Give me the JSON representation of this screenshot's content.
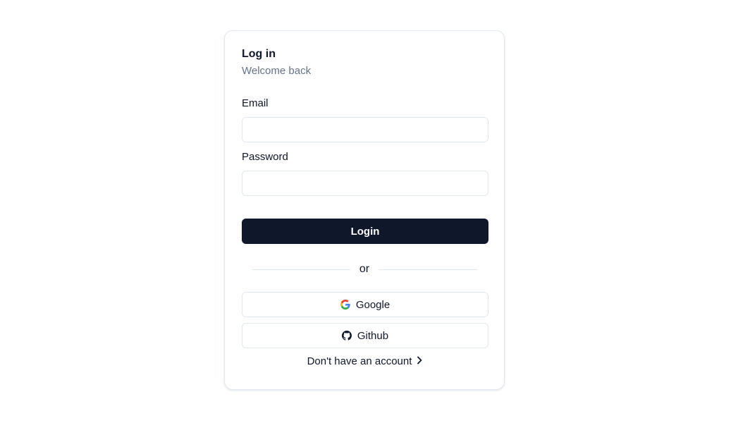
{
  "login_card": {
    "title": "Log in",
    "subtitle": "Welcome back",
    "email": {
      "label": "Email",
      "value": "",
      "placeholder": ""
    },
    "password": {
      "label": "Password",
      "value": "",
      "placeholder": ""
    },
    "login_label": "Login",
    "divider_text": "or",
    "oauth": {
      "google_label": "Google",
      "github_label": "Github"
    },
    "signup_link_label": "Don't have an account"
  },
  "icons": {
    "google": "google-icon",
    "github": "github-icon",
    "chevron": "chevron-right-icon"
  },
  "colors": {
    "primary_button_bg": "#0f172a",
    "primary_button_text": "#ffffff",
    "muted_text": "#64748b",
    "border": "#e2e8f0",
    "text": "#0f172a"
  }
}
